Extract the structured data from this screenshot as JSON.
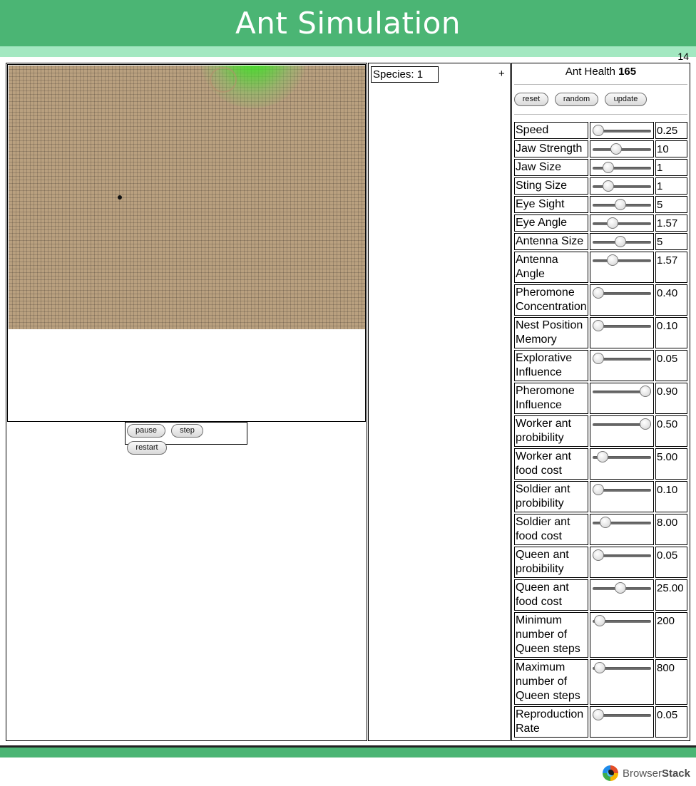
{
  "header": {
    "title": "Ant Simulation",
    "counter": "14"
  },
  "simulation": {
    "controls": {
      "pause_label": "pause",
      "step_label": "step",
      "restart_label": "restart"
    }
  },
  "species": {
    "label": "Species: 1",
    "add_label": "+"
  },
  "settings": {
    "health_label": "Ant Health",
    "health_value": "165",
    "buttons": {
      "reset_label": "reset",
      "random_label": "random",
      "update_label": "update"
    },
    "params": [
      {
        "label": "Speed",
        "value": "0.25",
        "level": 0.0
      },
      {
        "label": "Jaw Strength",
        "value": "10",
        "level": 0.38
      },
      {
        "label": "Jaw Size",
        "value": "1",
        "level": 0.21
      },
      {
        "label": "Sting Size",
        "value": "1",
        "level": 0.21
      },
      {
        "label": "Eye Sight",
        "value": "5",
        "level": 0.47
      },
      {
        "label": "Eye Angle",
        "value": "1.57",
        "level": 0.31
      },
      {
        "label": "Antenna Size",
        "value": "5",
        "level": 0.47
      },
      {
        "label": "Antenna Angle",
        "value": "1.57",
        "level": 0.31
      },
      {
        "label": "Pheromone Concentration",
        "value": "0.40",
        "level": 0.0
      },
      {
        "label": "Nest Position Memory",
        "value": "0.10",
        "level": 0.0
      },
      {
        "label": "Explorative Influence",
        "value": "0.05",
        "level": 0.0
      },
      {
        "label": "Pheromone Influence",
        "value": "0.90",
        "level": 1.0
      },
      {
        "label": "Worker ant probibility",
        "value": "0.50",
        "level": 1.0
      },
      {
        "label": "Worker ant food cost",
        "value": "5.00",
        "level": 0.09
      },
      {
        "label": "Soldier ant probibility",
        "value": "0.10",
        "level": 0.0
      },
      {
        "label": "Soldier ant food cost",
        "value": "8.00",
        "level": 0.15
      },
      {
        "label": "Queen ant probibility",
        "value": "0.05",
        "level": 0.0
      },
      {
        "label": "Queen ant food cost",
        "value": "25.00",
        "level": 0.47
      },
      {
        "label": "Minimum number of Queen steps",
        "value": "200",
        "level": 0.03
      },
      {
        "label": "Maximum number of Queen steps",
        "value": "800",
        "level": 0.03
      },
      {
        "label": "Reproduction Rate",
        "value": "0.05",
        "level": 0.0
      }
    ]
  },
  "footer": {
    "brand_prefix": "Browser",
    "brand_suffix": "Stack"
  }
}
